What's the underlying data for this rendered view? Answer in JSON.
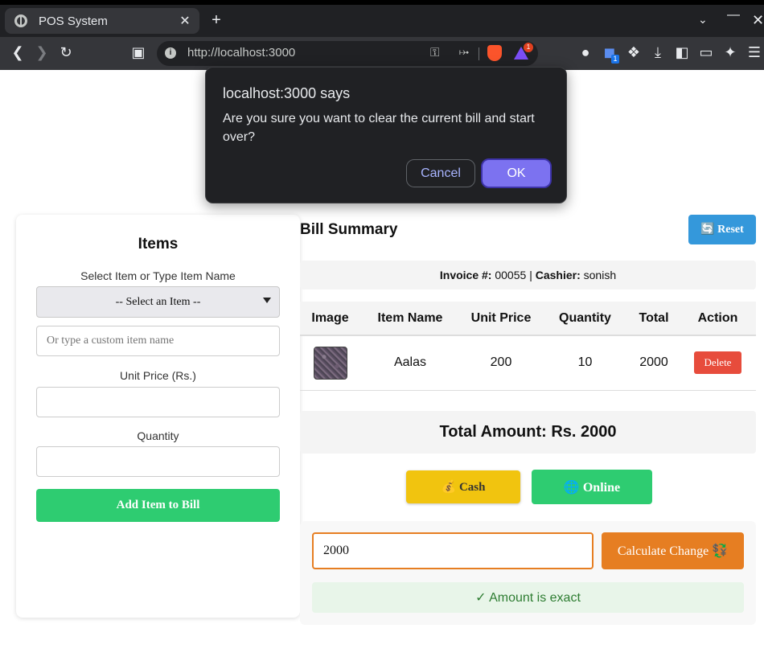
{
  "browser": {
    "tab_title": "POS System",
    "tab_close": "✕",
    "new_tab": "+",
    "url": "http://localhost:3000",
    "rewards_badge": "1",
    "extension_badge": "1"
  },
  "dialog": {
    "title": "localhost:3000 says",
    "message": "Are you sure you want to clear the current bill and start over?",
    "cancel_label": "Cancel",
    "ok_label": "OK"
  },
  "items_panel": {
    "title": "Items",
    "select_label": "Select Item or Type Item Name",
    "select_value": "-- Select an Item --",
    "custom_name_placeholder": "Or type a custom item name",
    "unit_price_label": "Unit Price (Rs.)",
    "quantity_label": "Quantity",
    "add_button": "Add Item to Bill"
  },
  "bill": {
    "title": "Bill Summary",
    "reset_label": "🔄 Reset",
    "invoice_label": "Invoice #:",
    "invoice_number": "00055",
    "separator": "|",
    "cashier_label": "Cashier:",
    "cashier_name": "sonish",
    "columns": [
      "Image",
      "Item Name",
      "Unit Price",
      "Quantity",
      "Total",
      "Action"
    ],
    "rows": [
      {
        "name": "Aalas",
        "unit_price": "200",
        "quantity": "10",
        "total": "2000",
        "action": "Delete"
      }
    ],
    "total_text": "Total Amount: Rs. 2000"
  },
  "payment": {
    "cash_label": "💰 Cash",
    "online_label": "🌐 Online",
    "amount_value": "2000",
    "calculate_label": "Calculate Change 💱",
    "status_text": "✓ Amount is exact"
  },
  "colors": {
    "green": "#2ecc71",
    "blue": "#3498db",
    "red": "#e74c3c",
    "orange": "#e67e22",
    "yellow": "#f1c40f",
    "dialog_bg": "#202124",
    "dialog_ok": "#7c72f0"
  }
}
